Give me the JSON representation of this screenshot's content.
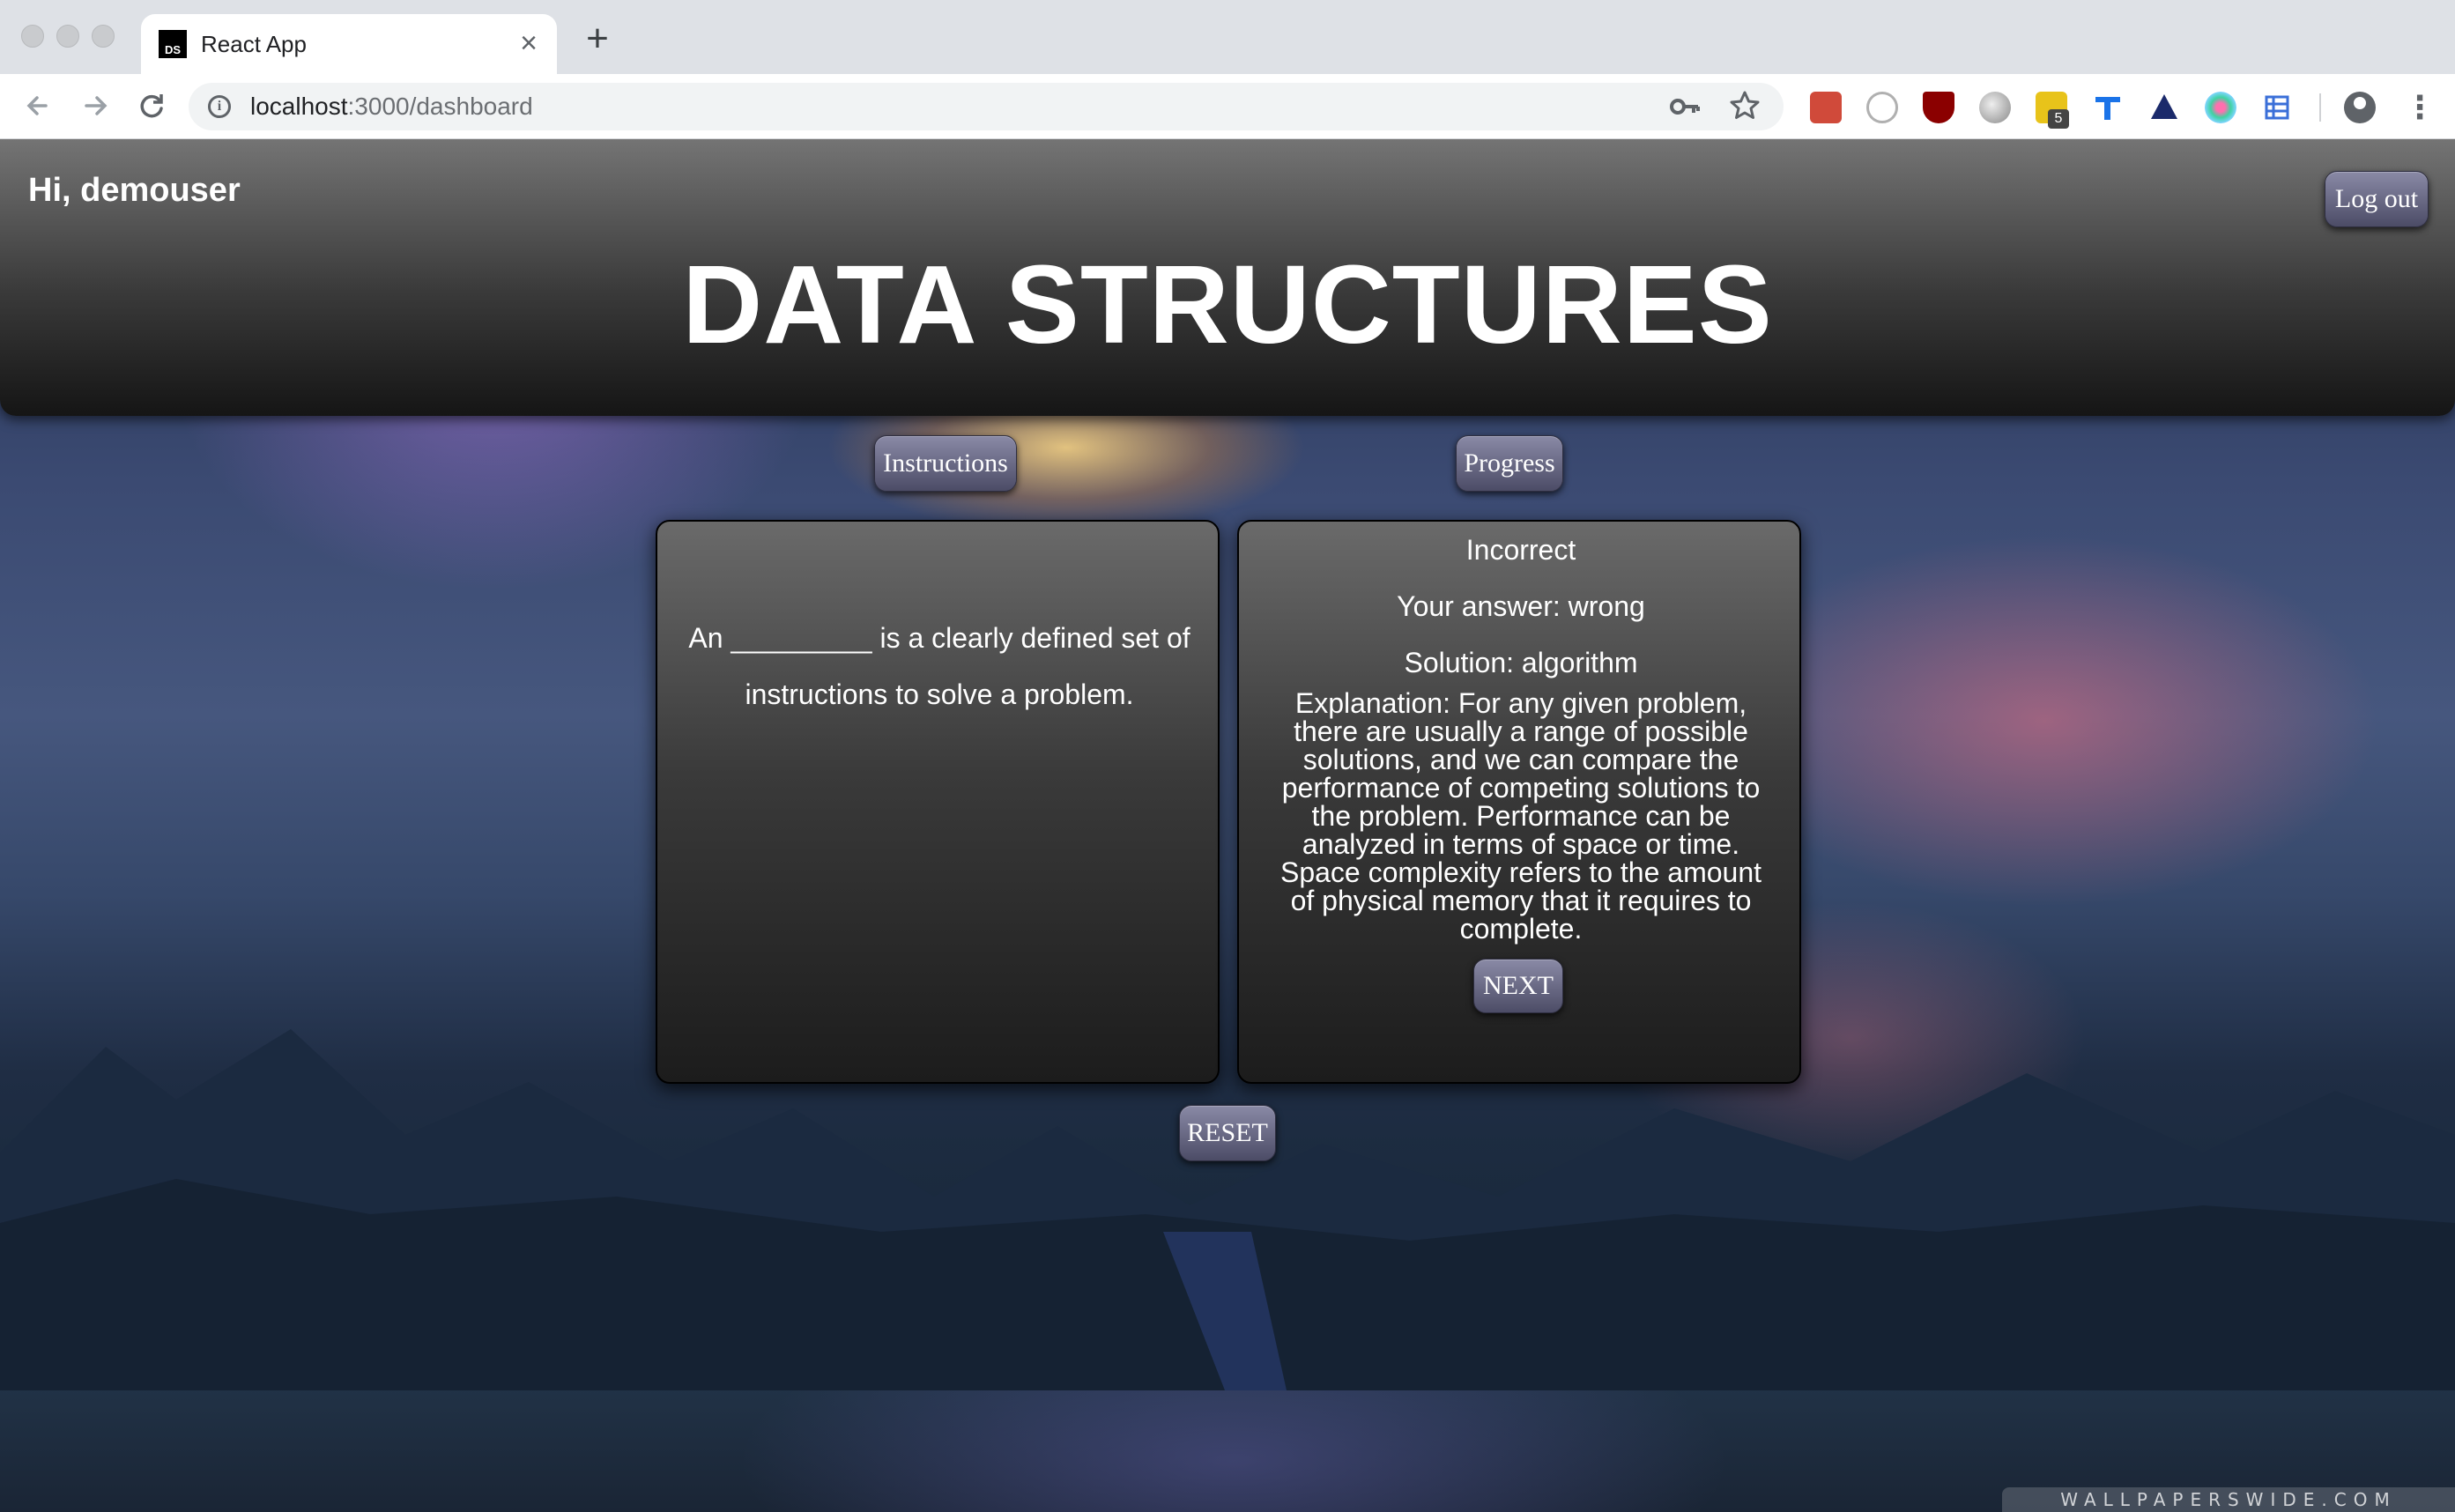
{
  "browser": {
    "tab_title": "React App",
    "tab_favicon_text": "DS",
    "new_tab_symbol": "+",
    "close_symbol": "×",
    "url_host": "localhost",
    "url_path": ":3000/dashboard",
    "extension_badge": "5",
    "icons": [
      "back-arrow-icon",
      "forward-arrow-icon",
      "reload-icon",
      "info-icon",
      "key-icon",
      "star-icon",
      "account-icon",
      "kebab-menu-icon"
    ]
  },
  "header": {
    "greeting": "Hi, demouser",
    "title": "DATA STRUCTURES",
    "logout_label": "Log out"
  },
  "nav": {
    "instructions_label": "Instructions",
    "progress_label": "Progress"
  },
  "question": {
    "text": "An _________ is a clearly defined set of instructions to solve a problem."
  },
  "answer": {
    "result": "Incorrect",
    "your_answer": "Your answer: wrong",
    "solution": "Solution: algorithm",
    "explanation": "Explanation: For any given problem, there are usually a range of possible solutions, and we can compare the performance of competing solutions to the problem. Performance can be analyzed in terms of space or time. Space complexity refers to the amount of physical memory that it requires to complete.",
    "next_label": "NEXT"
  },
  "footer": {
    "reset_label": "RESET",
    "watermark": "WALLPAPERSWIDE.COM"
  },
  "colors": {
    "button_top": "#8a8aa6",
    "button_bottom": "#4c4c66",
    "header_top": "#747474",
    "header_bottom": "#151515"
  }
}
